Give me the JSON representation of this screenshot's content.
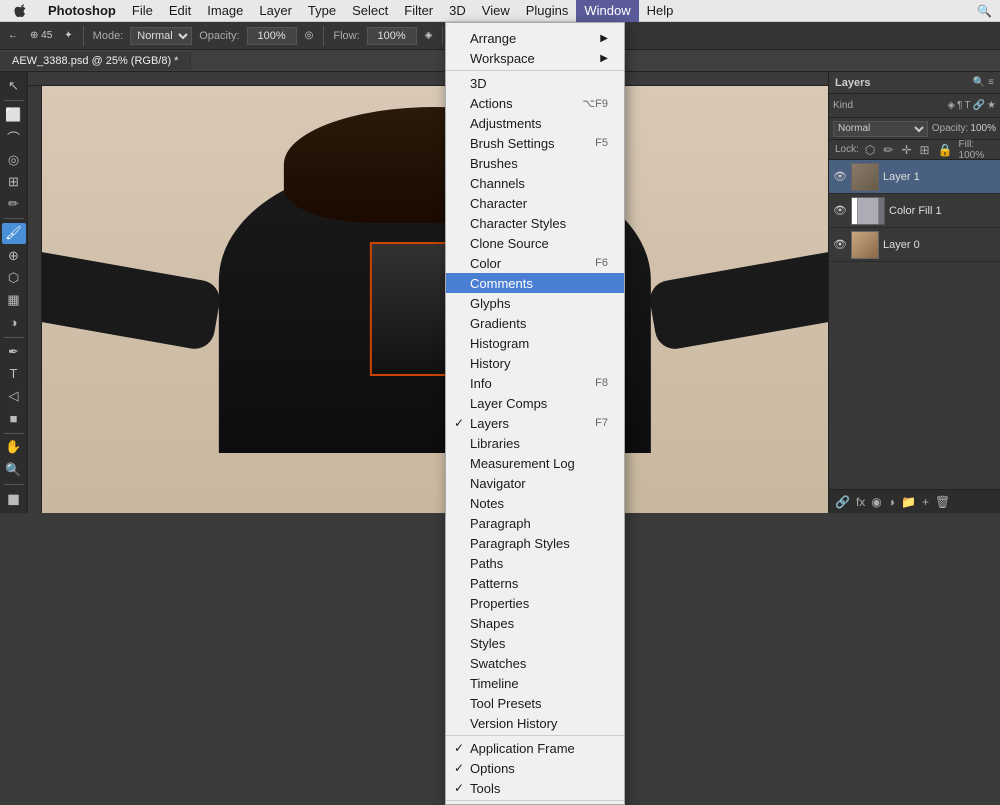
{
  "app": {
    "name": "Photoshop",
    "document": "AEW_3388.psd @ 25% (RGB/8) *"
  },
  "menubar": {
    "apple": "⌘",
    "items": [
      "Photoshop",
      "File",
      "Edit",
      "Image",
      "Layer",
      "Type",
      "Select",
      "Filter",
      "3D",
      "View",
      "Plugins",
      "Window",
      "Help"
    ]
  },
  "toolbar": {
    "mode_label": "Mode:",
    "mode_value": "Normal",
    "opacity_label": "Opacity:",
    "opacity_value": "100%",
    "flow_label": "Flow:",
    "flow_value": "100%"
  },
  "window_menu": {
    "sections": [
      {
        "items": [
          {
            "label": "Arrange",
            "has_arrow": true
          },
          {
            "label": "Workspace",
            "has_arrow": true
          }
        ]
      },
      {
        "items": [
          {
            "label": "3D"
          },
          {
            "label": "Actions",
            "shortcut": "⌥F9"
          },
          {
            "label": "Adjustments"
          },
          {
            "label": "Brush Settings",
            "shortcut": "F5"
          },
          {
            "label": "Brushes"
          },
          {
            "label": "Channels"
          },
          {
            "label": "Character"
          },
          {
            "label": "Character Styles"
          },
          {
            "label": "Clone Source"
          },
          {
            "label": "Color",
            "shortcut": "F6"
          },
          {
            "label": "Comments",
            "highlighted": true
          },
          {
            "label": "Glyphs"
          },
          {
            "label": "Gradients"
          },
          {
            "label": "Histogram"
          },
          {
            "label": "History"
          },
          {
            "label": "Info",
            "shortcut": "F8"
          },
          {
            "label": "Layer Comps"
          },
          {
            "label": "Layers",
            "shortcut": "F7",
            "checked": true
          },
          {
            "label": "Libraries"
          },
          {
            "label": "Measurement Log"
          },
          {
            "label": "Navigator"
          },
          {
            "label": "Notes"
          },
          {
            "label": "Paragraph"
          },
          {
            "label": "Paragraph Styles"
          },
          {
            "label": "Paths"
          },
          {
            "label": "Patterns"
          },
          {
            "label": "Properties"
          },
          {
            "label": "Shapes"
          },
          {
            "label": "Styles"
          },
          {
            "label": "Swatches"
          },
          {
            "label": "Timeline"
          },
          {
            "label": "Tool Presets"
          },
          {
            "label": "Version History"
          }
        ]
      },
      {
        "items": [
          {
            "label": "Application Frame",
            "checked": true
          },
          {
            "label": "Options",
            "checked": true
          },
          {
            "label": "Tools",
            "checked": true
          }
        ]
      }
    ]
  },
  "layers_panel": {
    "title": "Layers",
    "filter_label": "Kind",
    "mode": "Normal",
    "opacity_label": "Opacity:",
    "opacity_value": "100%",
    "lock_label": "Lock:",
    "fill_label": "Fill:",
    "fill_value": "100%",
    "layers": [
      {
        "name": "Layer 1",
        "type": "photo",
        "visible": true
      },
      {
        "name": "Color Fill 1",
        "type": "fill",
        "visible": true
      },
      {
        "name": "Layer 0",
        "type": "photo",
        "visible": true
      }
    ]
  }
}
